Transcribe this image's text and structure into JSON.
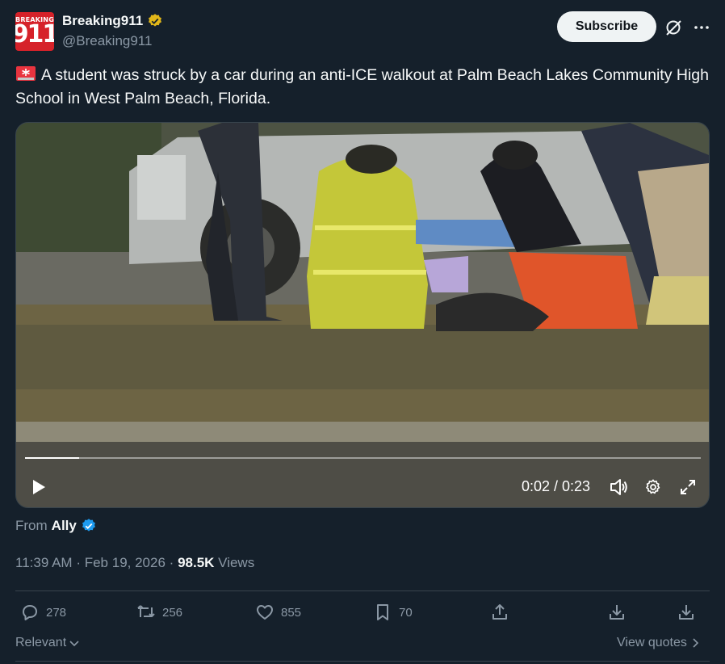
{
  "account": {
    "avatar_small": "BREAKING",
    "avatar_big": "911",
    "name": "Breaking911",
    "handle": "@Breaking911"
  },
  "header": {
    "subscribe_label": "Subscribe"
  },
  "tweet": {
    "text": "A student was struck by a car during an anti-ICE walkout at Palm Beach Lakes Community High School in West Palm Beach, Florida."
  },
  "video": {
    "time": "0:02 / 0:23",
    "progress": 0.08
  },
  "attribution": {
    "from_label": "From",
    "source": "Ally"
  },
  "meta": {
    "time": "11:39 AM",
    "date": "Feb 19, 2026",
    "views_count": "98.5K",
    "views_label": "Views",
    "sep": "·"
  },
  "actions": {
    "replies": "278",
    "reposts": "256",
    "likes": "855",
    "bookmarks": "70"
  },
  "footer": {
    "relevant": "Relevant",
    "view_quotes": "View quotes"
  },
  "colors": {
    "background": "#15202b",
    "text": "#f7f9f9",
    "muted": "#8b98a5",
    "verified_gold": "#e2b719",
    "verified_blue": "#1d9bf0",
    "avatar_red": "#d6222a"
  }
}
